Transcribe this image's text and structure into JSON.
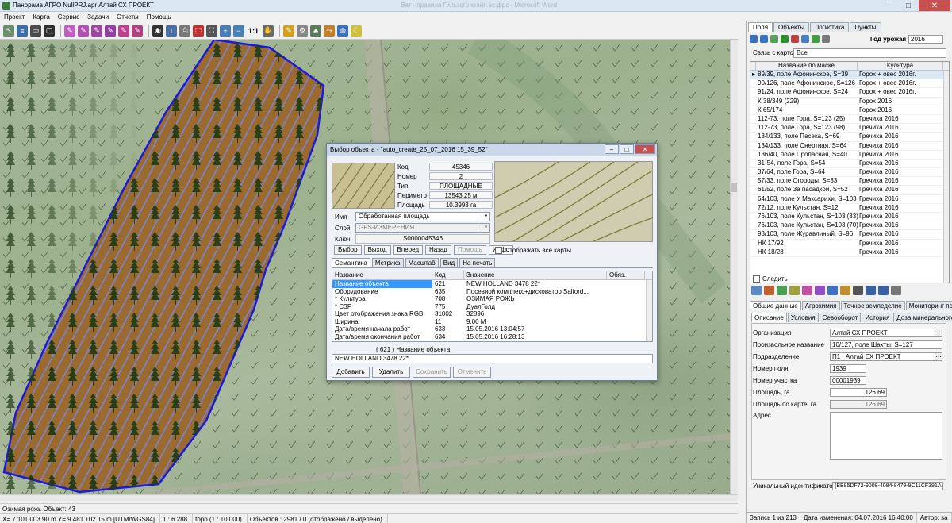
{
  "window": {
    "title": "Панорама АГРО  NullPRJ.apr     Алтай СХ ПРОЕКТ",
    "faded_title": "Ват - правила Гильзого кхэйп.вс.фрс - Microsoft Word"
  },
  "menu": [
    "Проект",
    "Карта",
    "Сервис",
    "Задачи",
    "Отчеты",
    "Помощь"
  ],
  "toolbar": {
    "scale_label": "1:1"
  },
  "status": {
    "line1": "Озимая рожь Объект: 43",
    "coords": "X= 7 101 003.90 m   Y= 9 481 102.15 m  [UTM/WGS84]",
    "map_scale": "1 : 6 288",
    "topo": "topo (1 : 10 000)",
    "objects": "Объектов : 2981 / 0 (отображено / выделено)"
  },
  "dialog": {
    "title": "Выбор объекта - \"auto_create_25_07_2016 15_39_52\"",
    "props": [
      {
        "label": "Код",
        "value": "45346"
      },
      {
        "label": "Номер",
        "value": "2"
      },
      {
        "label": "Тип",
        "value": "ПЛОЩАДНЫЕ"
      },
      {
        "label": "Периметр",
        "value": "13543.25  м"
      },
      {
        "label": "Площадь",
        "value": "10.3993  га"
      }
    ],
    "name_label": "Имя",
    "name_value": "Обработанная площадь",
    "layer_label": "Слой",
    "layer_value": "GPS-ИЗМЕРЕНИЯ",
    "key_label": "Ключ",
    "key_value": "S0000045346",
    "nav": [
      "Выбор",
      "Выход",
      "Вперед",
      "Назад",
      "Помощь",
      "Инфо"
    ],
    "show_all_maps": "Отображать все карты",
    "tabs": [
      "Семантика",
      "Метрика",
      "Масштаб",
      "Вид",
      "На печать"
    ],
    "grid_headers": [
      "Название",
      "Код",
      "Значение",
      "Обяз."
    ],
    "grid_rows": [
      [
        "Название объекта",
        "621",
        "NEW HOLLAND 3478 22*",
        ""
      ],
      [
        "Оборудование",
        "635",
        "Посевной комплекс+дисковатор Salford...",
        ""
      ],
      [
        "* Культура",
        "708",
        "ОЗИМАЯ РОЖЬ",
        ""
      ],
      [
        "* СЗР",
        "775",
        "ДуалГолд",
        ""
      ],
      [
        "Цвет отображения знака RGB",
        "31002",
        "32896",
        ""
      ],
      [
        "Ширина",
        "11",
        "9.00 M",
        ""
      ],
      [
        "Дата/время начала работ",
        "633",
        "15.05.2016 13:04:57",
        ""
      ],
      [
        "Дата/время окончания работ",
        "634",
        "15.05.2016 16:28:13",
        ""
      ]
    ],
    "caption": "( 621 ) Название объекта",
    "edit_value": "NEW HOLLAND 3478 22*",
    "actions": [
      "Добавить",
      "Удалить",
      "Сохранить",
      "Отменить"
    ]
  },
  "panel": {
    "tabs": [
      "Поля",
      "Объекты",
      "Логистика",
      "Пункты"
    ],
    "year_label": "Год урожая",
    "year_value": "2016",
    "link_label": "Связь с картой",
    "link_value": "Все",
    "list_headers": [
      "Название по маске",
      "Культура"
    ],
    "fields": [
      [
        "89/39, поле Афонинское, S=39",
        "Горох + овес 2016г."
      ],
      [
        "90/126, поле Афонинское, S=126",
        "Горох + овес 2016г."
      ],
      [
        "91/24, поле Афонинское, S=24",
        "Горох + овес 2016г."
      ],
      [
        "К 38/349 (229)",
        "Горох 2016"
      ],
      [
        "К 65/174",
        "Горох 2016"
      ],
      [
        "112-73, поле Гора, S=123 (25)",
        "Гречиха 2016"
      ],
      [
        "112-73, поле Гора, S=123 (98)",
        "Гречиха 2016"
      ],
      [
        "134/133, поле Пасека, S=69",
        "Гречиха 2016"
      ],
      [
        "134/133, поле Снертная, S=64",
        "Гречиха 2016"
      ],
      [
        "136/40, поле Пропасная, S=40",
        "Гречиха 2016"
      ],
      [
        "31-54, поле Гора, S=54",
        "Гречиха 2016"
      ],
      [
        "37/64, поле Гора, S=64",
        "Гречиха 2016"
      ],
      [
        "57/33, поле Огороды, S=33",
        "Гречиха 2016"
      ],
      [
        "61/52, поле За пасадкой,  S=52",
        "Гречиха 2016"
      ],
      [
        "64/103, поле У Максарихи,  S=103",
        "Гречиха 2016"
      ],
      [
        "72/12, поле Кульстан, S=12",
        "Гречиха 2016"
      ],
      [
        "76/103, поле Кульстан, S=103 (33)",
        "Гречиха 2016"
      ],
      [
        "76/103, поле Кульстан, S=103 (70)",
        "Гречиха 2016"
      ],
      [
        "93/103, поле Журавлиный, S=96",
        "Гречиха 2016"
      ],
      [
        "НК 17/92",
        "Гречиха 2016"
      ],
      [
        "НК 18/28",
        "Гречиха 2016"
      ]
    ],
    "follow": "Следить",
    "tabs2": [
      "Общие данные",
      "Агрохимия",
      "Точное земледелие",
      "Мониторинг посевов"
    ],
    "tabs3": [
      "Описание",
      "Условия",
      "Севооборот",
      "История",
      "Доза минерального удобрения"
    ],
    "form": {
      "org_label": "Организация",
      "org": "Алтай СХ ПРОЕКТ",
      "name_label": "Произвольное название",
      "name": "10/127, поле Шахты, S=127",
      "div_label": "Подразделение",
      "div": "П1 ; Алтай СХ ПРОЕКТ",
      "num_label": "Номер поля",
      "num": "1939",
      "plot_label": "Номер участка",
      "plot": "00001939",
      "area_label": "Площадь, га",
      "area": "126.69",
      "maparea_label": "Площадь по карте, га",
      "maparea": "126.69",
      "addr_label": "Адрес",
      "uid_label": "Уникальный идентификатор",
      "uid": "{BB85DF72-9008-4084-8479-9C11CF391A7D}"
    },
    "status": [
      "Запись 1 из 213",
      "Дата изменения: 04.07.2016 16:40:00",
      "Автор: sa"
    ]
  }
}
